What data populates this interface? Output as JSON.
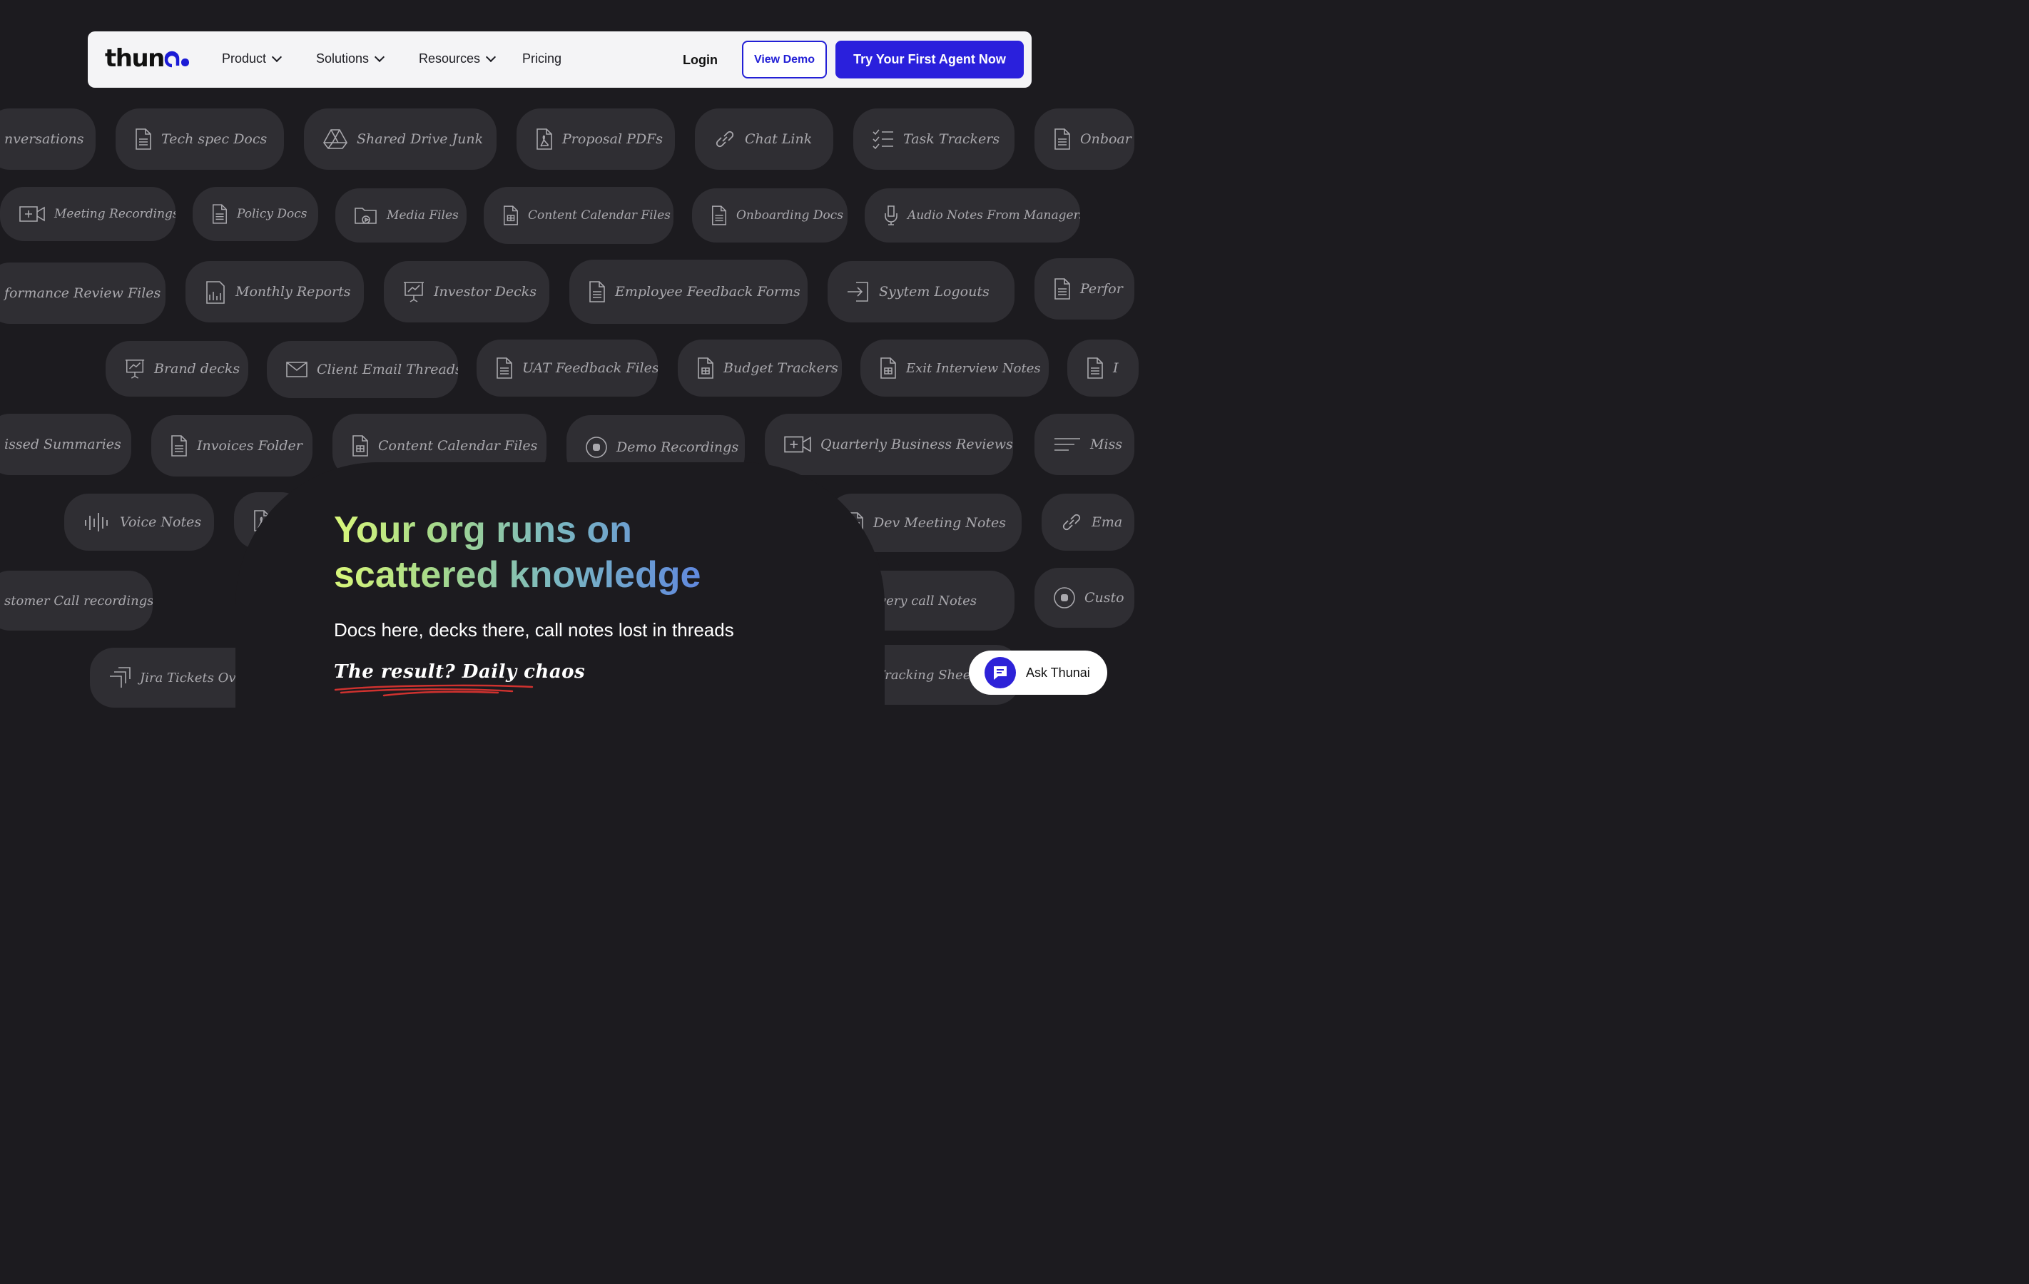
{
  "nav": {
    "logo_text": "thun",
    "logo_ai": "ai",
    "items": [
      {
        "label": "Product",
        "dropdown": true
      },
      {
        "label": "Solutions",
        "dropdown": true
      },
      {
        "label": "Resources",
        "dropdown": true
      },
      {
        "label": "Pricing",
        "dropdown": false
      }
    ],
    "login": "Login",
    "demo_button": "View Demo",
    "cta_button": "Try Your First Agent Now"
  },
  "chips": [
    {
      "label": "nversations",
      "icon": "none"
    },
    {
      "label": "Tech spec Docs",
      "icon": "document-icon"
    },
    {
      "label": "Shared Drive Junk",
      "icon": "drive-icon"
    },
    {
      "label": "Proposal PDFs",
      "icon": "pdf-icon"
    },
    {
      "label": "Chat Link",
      "icon": "link-icon"
    },
    {
      "label": "Task Trackers",
      "icon": "checklist-icon"
    },
    {
      "label": "Onboar",
      "icon": "document-icon"
    },
    {
      "label": "Meeting Recordings",
      "icon": "video-icon"
    },
    {
      "label": "Policy Docs",
      "icon": "document-icon"
    },
    {
      "label": "Media Files",
      "icon": "media-folder-icon"
    },
    {
      "label": "Content Calendar Files",
      "icon": "spreadsheet-icon"
    },
    {
      "label": "Onboarding Docs",
      "icon": "document-icon"
    },
    {
      "label": "Audio Notes From Managers",
      "icon": "microphone-icon"
    },
    {
      "label": "formance Review Files",
      "icon": "none"
    },
    {
      "label": "Monthly Reports",
      "icon": "report-icon"
    },
    {
      "label": "Investor Decks",
      "icon": "presentation-icon"
    },
    {
      "label": "Employee Feedback Forms",
      "icon": "document-icon"
    },
    {
      "label": "Syytem Logouts",
      "icon": "logout-icon"
    },
    {
      "label": "Perfor",
      "icon": "document-icon"
    },
    {
      "label": "Brand decks",
      "icon": "presentation-icon"
    },
    {
      "label": "Client Email Threads",
      "icon": "email-icon"
    },
    {
      "label": "UAT Feedback Files",
      "icon": "document-icon"
    },
    {
      "label": "Budget Trackers",
      "icon": "spreadsheet-icon"
    },
    {
      "label": "Exit Interview Notes",
      "icon": "spreadsheet-icon"
    },
    {
      "label": "I",
      "icon": "document-icon"
    },
    {
      "label": "issed Summaries",
      "icon": "none"
    },
    {
      "label": "Invoices Folder",
      "icon": "document-icon"
    },
    {
      "label": "Content Calendar Files",
      "icon": "spreadsheet-icon"
    },
    {
      "label": "Demo Recordings",
      "icon": "record-icon"
    },
    {
      "label": "Quarterly Business Reviews",
      "icon": "video-icon"
    },
    {
      "label": "Miss",
      "icon": "lines-icon"
    },
    {
      "label": "Voice Notes",
      "icon": "waveform-icon"
    },
    {
      "label": "Dev Meeting Notes",
      "icon": "document-icon"
    },
    {
      "label": "Ema",
      "icon": "link-icon"
    },
    {
      "label": "stomer Call recordings",
      "icon": "none"
    },
    {
      "label": "iscovery call Notes",
      "icon": "none"
    },
    {
      "label": "Custo",
      "icon": "record-icon"
    },
    {
      "label": "Jira Tickets Overloa",
      "icon": "jira-icon"
    },
    {
      "label": "al Tracking Sheets",
      "icon": "none"
    }
  ],
  "hero": {
    "headline_line1": "Your org runs on",
    "headline_line2": "scattered knowledge",
    "subtitle": "Docs here, decks there, call notes lost in threads",
    "result": "The result? Daily chaos"
  },
  "ask_widget": {
    "label": "Ask Thunai"
  },
  "colors": {
    "background": "#1c1b1f",
    "chip": "#2f2e33",
    "accent": "#2a20dc",
    "headline_gradient": [
      "#d9f77a",
      "#7bb8c0",
      "#5a7ee6"
    ],
    "underline": "#d0322f"
  }
}
